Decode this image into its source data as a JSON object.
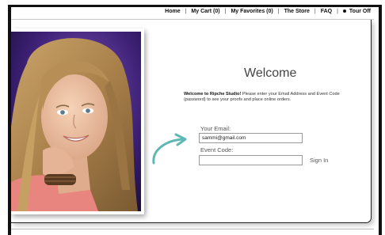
{
  "nav": {
    "items": [
      "Home",
      "My Cart (0)",
      "My Favorites (0)",
      "The Store",
      "FAQ"
    ],
    "tour_label": "Tour Off"
  },
  "content": {
    "title": "Welcome",
    "intro_bold": "Welcome to Ripche Studio!",
    "intro_text": "Please enter your Email Address and Event Code (password) to see your proofs and place online orders."
  },
  "form": {
    "email_label": "Your Email:",
    "email_value": "sammi@gmail.com",
    "code_label": "Event Code:",
    "code_value": "",
    "submit_label": "Sign In"
  },
  "colors": {
    "accent_arrow": "#5fb8b4",
    "frame": "#111111"
  },
  "icons": {
    "tour_toggle": "bullet-dot-icon",
    "pointer": "curved-arrow-icon"
  }
}
